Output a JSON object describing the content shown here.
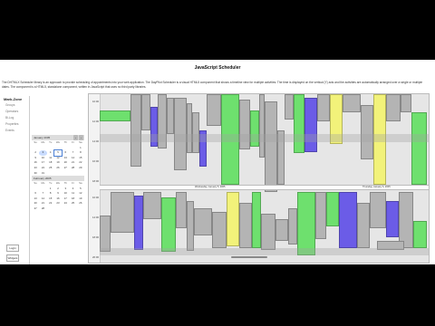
{
  "page": {
    "title": "JavaScript Scheduler",
    "description": "The DHTMLX Scheduler library is an approach to provide scheduling of appointments into your web application. The DayPilot Scheduler is a visual HTML5 component that shows a timeline view for multiple activities. The time is displayed on the vertical (Y) axis and the activities are automatically arranged over a single or multiple dates. The component is a HTML5, standalone component, written in JavaScript that uses no third party libraries."
  },
  "sidebar": {
    "brand": "Mark-Zone",
    "items": [
      "Groups",
      "Operators",
      "Bi-Log",
      "Properties",
      "Events"
    ],
    "buttons": [
      "Login",
      "Widgets"
    ]
  },
  "calendars": [
    {
      "month": "January 2005",
      "dow": [
        "Su",
        "Mo",
        "Tu",
        "We",
        "Th",
        "Fr",
        "Sa"
      ],
      "days": [
        "",
        "",
        "",
        "",
        "",
        "",
        "1",
        "2",
        "3",
        "4",
        "5",
        "6",
        "7",
        "8",
        "9",
        "10",
        "11",
        "12",
        "13",
        "14",
        "15",
        "16",
        "17",
        "18",
        "19",
        "20",
        "21",
        "22",
        "23",
        "24",
        "25",
        "26",
        "27",
        "28",
        "29",
        "30",
        "31",
        "",
        "",
        "",
        "",
        ""
      ],
      "selected": "3",
      "today": "5"
    },
    {
      "month": "February 2005",
      "dow": [
        "Su",
        "Mo",
        "Tu",
        "We",
        "Th",
        "Fr",
        "Sa"
      ],
      "days": [
        "",
        "",
        "1",
        "2",
        "3",
        "4",
        "5",
        "6",
        "7",
        "8",
        "9",
        "10",
        "11",
        "12",
        "13",
        "14",
        "15",
        "16",
        "17",
        "18",
        "19",
        "20",
        "21",
        "22",
        "23",
        "24",
        "25",
        "26",
        "27",
        "28",
        "",
        "",
        "",
        "",
        ""
      ],
      "selected": "",
      "today": ""
    }
  ],
  "schedule": {
    "time_labels_top": [
      "10:00",
      "",
      "12:00",
      "",
      "14:00",
      "",
      "16:00",
      "",
      "18:00"
    ],
    "time_labels_bottom": [
      "10:00",
      "",
      "14:00",
      "",
      "18:00",
      "",
      "20:00"
    ],
    "day_headers": [
      "Wednesday, January 5, 2005",
      "Thursday, January 6, 2005"
    ],
    "colors": {
      "blue": "#6b5ce7",
      "green": "#6ee06e",
      "yellow": "#f2f27a",
      "gray": "#b4b4b4"
    }
  }
}
